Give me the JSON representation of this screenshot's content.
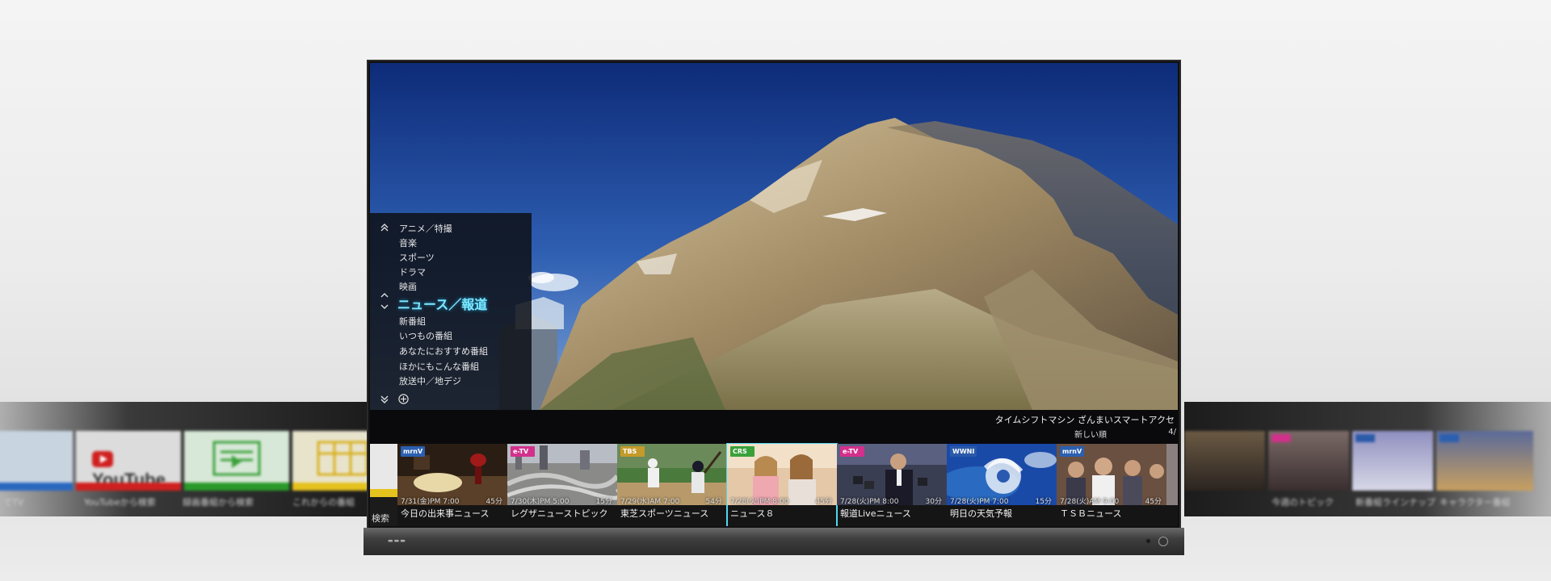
{
  "genre_menu": {
    "items": [
      {
        "label": "アニメ／特撮"
      },
      {
        "label": "音楽"
      },
      {
        "label": "スポーツ"
      },
      {
        "label": "ドラマ"
      },
      {
        "label": "映画"
      },
      {
        "label": "ニュース／報道",
        "selected": true
      },
      {
        "label": "新番組"
      },
      {
        "label": "いつもの番組"
      },
      {
        "label": "あなたにおすすめ番組"
      },
      {
        "label": "ほかにもこんな番組"
      },
      {
        "label": "放送中／地デジ"
      }
    ],
    "icons": [
      "double-chevron-up-icon",
      "chevron-up-down-icon",
      "double-chevron-down-icon",
      "add-circle-icon"
    ]
  },
  "info_bar": {
    "title": "タイムシフトマシン ざんまいスマートアクセ",
    "sort": "新しい順",
    "page": "4/"
  },
  "search": {
    "label": "検索"
  },
  "programs": [
    {
      "channel": "mrnV",
      "channel_color": "#2b5fb0",
      "datetime": "7/31(金)PM 7:00",
      "duration": "45分",
      "title": "今日の出来事ニュース"
    },
    {
      "channel": "e-TV",
      "channel_color": "#d2308c",
      "datetime": "7/30(木)PM 5:00",
      "duration": "15分",
      "title": "レグザニューストピック"
    },
    {
      "channel": "TBS",
      "channel_color": "#c49a2a",
      "datetime": "7/29(水)AM 7:00",
      "duration": "54分",
      "title": "東芝スポーツニュース"
    },
    {
      "channel": "CRS",
      "channel_color": "#3aa13a",
      "datetime": "7/28(火)PM 8:00",
      "duration": "45分",
      "title": "ニュース８",
      "focused": true
    },
    {
      "channel": "e-TV",
      "channel_color": "#d2308c",
      "datetime": "7/28(火)PM 8:00",
      "duration": "30分",
      "title": "報道Liveニュース"
    },
    {
      "channel": "WWNI",
      "channel_color": "#2a5aa8",
      "datetime": "7/28(火)PM 7:00",
      "duration": "15分",
      "title": "明日の天気予報"
    },
    {
      "channel": "mrnV",
      "channel_color": "#2b5fb0",
      "datetime": "7/28(火)AM 9:00",
      "duration": "45分",
      "title": "ＴＳＢニュース"
    }
  ],
  "left_apps": [
    {
      "caption": "でTV"
    },
    {
      "caption": "YouTubeから検索",
      "logo": "YouTube"
    },
    {
      "caption": "録画番組から検索"
    },
    {
      "caption": "これからの番組"
    }
  ],
  "right_ghost_captions": [
    "今週のトピック",
    "新番組ラインナップ",
    "キャラクター番組"
  ]
}
